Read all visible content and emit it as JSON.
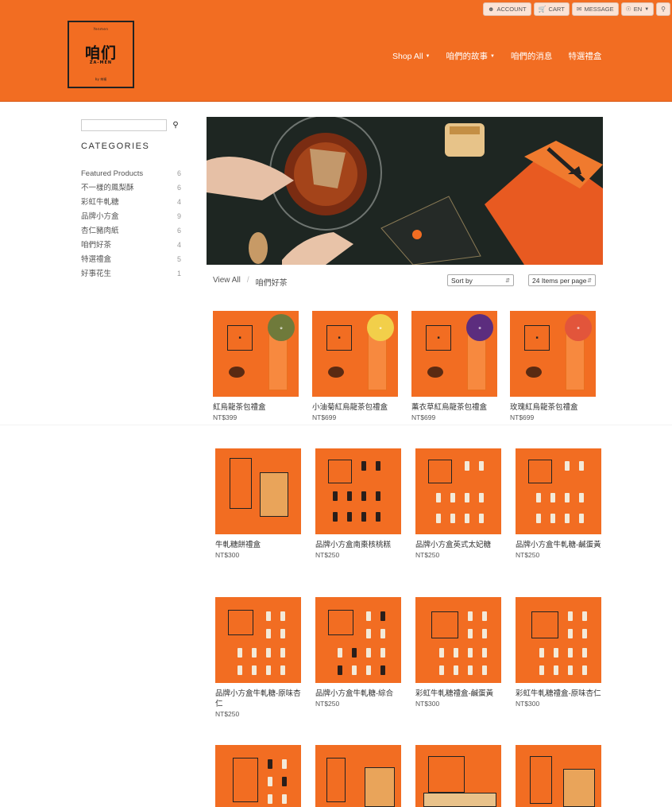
{
  "header": {
    "brand_color": "#f26d22",
    "logo": {
      "top_text": "Yenmen",
      "mark": "咱们",
      "sub": "ZA-MEN",
      "by": "by 來福"
    },
    "top_buttons": [
      {
        "label": "ACCOUNT",
        "icon": "user-icon"
      },
      {
        "label": "CART",
        "icon": "cart-icon"
      },
      {
        "label": "MESSAGE",
        "icon": "chat-icon"
      },
      {
        "label": "EN",
        "icon": "globe-icon"
      }
    ],
    "nav": [
      {
        "label": "Shop All",
        "dropdown": true
      },
      {
        "label": "咱們的故事",
        "dropdown": true
      },
      {
        "label": "咱們的消息",
        "dropdown": false
      },
      {
        "label": "特選禮盒",
        "dropdown": false
      }
    ]
  },
  "sidebar": {
    "search_placeholder": "",
    "categories_title": "CATEGORIES",
    "categories": [
      {
        "name": "Featured Products",
        "count": "6"
      },
      {
        "name": "不一樣的鳳梨酥",
        "count": "6"
      },
      {
        "name": "彩虹牛軋糖",
        "count": "4"
      },
      {
        "name": "品牌小方盒",
        "count": "9"
      },
      {
        "name": "杏仁豬肉紙",
        "count": "6"
      },
      {
        "name": "咱們好茶",
        "count": "4"
      },
      {
        "name": "特選禮盒",
        "count": "5"
      },
      {
        "name": "好事花生",
        "count": "1"
      }
    ]
  },
  "toolbar": {
    "crumb_root": "View All",
    "crumb_sep": "/",
    "crumb_current": "咱們好茶",
    "sort_label": "Sort by",
    "per_page_label": "24 Items per page"
  },
  "products": [
    {
      "name": "紅烏龍茶包禮盒",
      "price": "NT$399"
    },
    {
      "name": "小油菊紅烏龍茶包禮盒",
      "price": "NT$699"
    },
    {
      "name": "薰衣草紅烏龍茶包禮盒",
      "price": "NT$699"
    },
    {
      "name": "玫瑰紅烏龍茶包禮盒",
      "price": "NT$699"
    },
    {
      "name": "牛軋糖餅禮盒",
      "price": "NT$300"
    },
    {
      "name": "品牌小方盒南棗核桃糕",
      "price": "NT$250"
    },
    {
      "name": "品牌小方盒英式太妃糖",
      "price": "NT$250"
    },
    {
      "name": "品牌小方盒牛軋糖-鹹蛋黃",
      "price": "NT$250"
    },
    {
      "name": "品牌小方盒牛軋糖-原味杏仁",
      "price": "NT$250"
    },
    {
      "name": "品牌小方盒牛軋糖-綜合",
      "price": "NT$250"
    },
    {
      "name": "彩虹牛軋糖禮盒-鹹蛋黃",
      "price": "NT$300"
    },
    {
      "name": "彩虹牛軋糖禮盒-原味杏仁",
      "price": "NT$300"
    }
  ]
}
